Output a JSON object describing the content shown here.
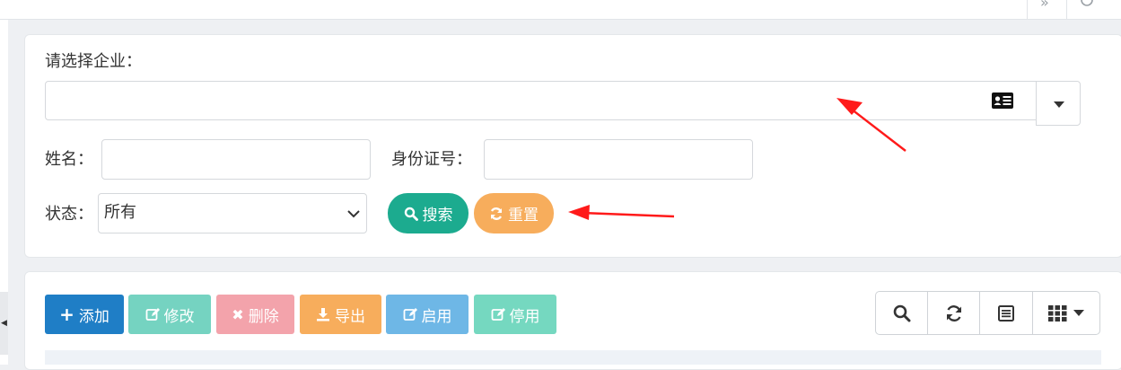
{
  "topbar": {
    "btn1_icon": "»",
    "btn2_text": ""
  },
  "search_form": {
    "enterprise_label": "请选择企业：",
    "enterprise_value": "",
    "name_label": "姓名：",
    "name_value": "",
    "id_label": "身份证号：",
    "id_value": "",
    "status_label": "状态：",
    "status_selected": "所有",
    "search_label": "搜索",
    "reset_label": "重置"
  },
  "toolbar": {
    "add_label": "添加",
    "edit_label": "修改",
    "delete_label": "删除",
    "export_label": "导出",
    "enable_label": "启用",
    "disable_label": "停用"
  },
  "colors": {
    "add": "#1f7ec6",
    "edit": "#75d3c1",
    "delete": "#f3a3ab",
    "export": "#f7ad5c",
    "enable": "#6eb7e6",
    "disable": "#75d8c0",
    "search": "#1cab8f",
    "reset": "#f7ad5c",
    "annotation_arrow": "#ff1a1a"
  },
  "icons": {
    "enterprise_picker": "id-card-icon",
    "dropdown": "caret-down-icon",
    "search": "search-icon",
    "reset": "refresh-icon",
    "add": "plus-icon",
    "edit": "edit-icon",
    "delete": "times-icon",
    "export": "download-icon",
    "enable": "edit-icon",
    "disable": "edit-icon",
    "table_search": "search-icon",
    "table_refresh": "refresh-icon",
    "table_toggle": "list-icon",
    "table_columns": "grid-icon"
  }
}
